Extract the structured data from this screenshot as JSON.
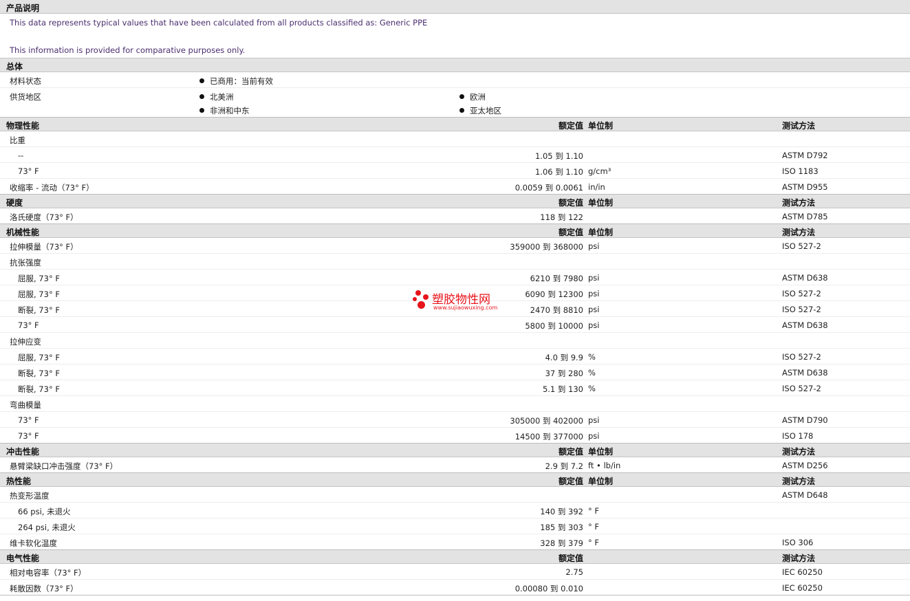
{
  "description": {
    "title": "产品说明",
    "line1": "This data represents typical values that have been calculated from all products classified as: Generic PPE",
    "line2": "This information is provided for comparative purposes only."
  },
  "general": {
    "title": "总体",
    "status_label": "材料状态",
    "status_value": "已商用：当前有效",
    "regions_label": "供货地区",
    "regions": [
      "北美洲",
      "欧洲",
      "非洲和中东",
      "亚太地区"
    ]
  },
  "headers": {
    "value": "额定值",
    "unit": "单位制",
    "method": "测试方法"
  },
  "physical": {
    "title": "物理性能",
    "rows": [
      {
        "label": "比重",
        "value": "",
        "unit": "",
        "method": ""
      },
      {
        "label": "--",
        "value": "1.05 到  1.10",
        "unit": "",
        "method": "ASTM D792"
      },
      {
        "label": "73°  F",
        "value": "1.06 到  1.10",
        "unit": "g/cm³",
        "method": "ISO 1183"
      },
      {
        "label": "收缩率  - 流动（73°  F）",
        "value": "0.0059 到  0.0061",
        "unit": "in/in",
        "method": "ASTM D955"
      }
    ]
  },
  "hardness": {
    "title": "硬度",
    "rows": [
      {
        "label": "洛氏硬度（73°  F）",
        "value": "118 到  122",
        "unit": "",
        "method": "ASTM D785"
      }
    ]
  },
  "mechanical": {
    "title": "机械性能",
    "rows": [
      {
        "label": "拉伸模量（73°  F）",
        "value": "359000 到  368000",
        "unit": "psi",
        "method": "ISO 527-2"
      },
      {
        "label": "抗张强度",
        "value": "",
        "unit": "",
        "method": ""
      },
      {
        "label": "屈服, 73°  F",
        "value": "6210 到  7980",
        "unit": "psi",
        "method": "ASTM D638"
      },
      {
        "label": "屈服, 73°  F",
        "value": "6090 到  12300",
        "unit": "psi",
        "method": "ISO 527-2"
      },
      {
        "label": "断裂, 73°  F",
        "value": "2470 到  8810",
        "unit": "psi",
        "method": "ISO 527-2"
      },
      {
        "label": "73°  F",
        "value": "5800 到  10000",
        "unit": "psi",
        "method": "ASTM D638"
      },
      {
        "label": "拉伸应变",
        "value": "",
        "unit": "",
        "method": ""
      },
      {
        "label": "屈服, 73°  F",
        "value": "4.0 到  9.9",
        "unit": "%",
        "method": "ISO 527-2"
      },
      {
        "label": "断裂, 73°  F",
        "value": "37 到  280",
        "unit": "%",
        "method": "ASTM D638"
      },
      {
        "label": "断裂, 73°  F",
        "value": "5.1 到  130",
        "unit": "%",
        "method": "ISO 527-2"
      },
      {
        "label": "弯曲模量",
        "value": "",
        "unit": "",
        "method": ""
      },
      {
        "label": "73°  F",
        "value": "305000 到  402000",
        "unit": "psi",
        "method": "ASTM D790"
      },
      {
        "label": "73°  F",
        "value": "14500 到  377000",
        "unit": "psi",
        "method": "ISO 178"
      }
    ]
  },
  "impact": {
    "title": "冲击性能",
    "rows": [
      {
        "label": "悬臂梁缺口冲击强度（73°  F）",
        "value": "2.9 到  7.2",
        "unit": "ft • lb/in",
        "method": "ASTM D256"
      }
    ]
  },
  "thermal": {
    "title": "热性能",
    "rows": [
      {
        "label": "热变形温度",
        "value": "",
        "unit": "",
        "method": "ASTM D648"
      },
      {
        "label": "66 psi, 未退火",
        "value": "140 到  392",
        "unit": "°  F",
        "method": ""
      },
      {
        "label": "264 psi, 未退火",
        "value": "185 到  303",
        "unit": "°  F",
        "method": ""
      },
      {
        "label": "维卡软化温度",
        "value": "328 到  379",
        "unit": "°  F",
        "method": "ISO 306"
      }
    ]
  },
  "electrical": {
    "title": "电气性能",
    "rows": [
      {
        "label": "相对电容率（73°  F）",
        "value": "2.75",
        "unit": "",
        "method": "IEC 60250"
      },
      {
        "label": "耗散因数（73°  F）",
        "value": "0.00080 到  0.010",
        "unit": "",
        "method": "IEC 60250"
      }
    ]
  },
  "watermark": {
    "title": "塑胶物性网",
    "url": "www.sujiaowuxing.com"
  }
}
